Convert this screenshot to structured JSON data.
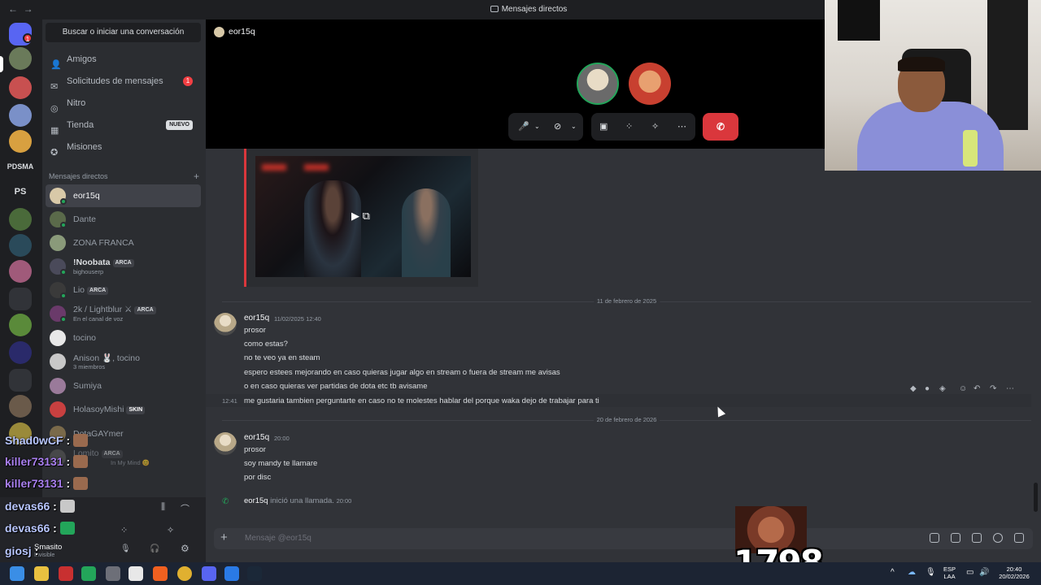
{
  "window": {
    "title": "Mensajes directos"
  },
  "servers": [
    {
      "label": "PDSMA"
    },
    {
      "label": "PS"
    }
  ],
  "sidebar": {
    "search_label": "Buscar o iniciar una conversación",
    "nav": [
      {
        "label": "Amigos",
        "icon": "friends-icon"
      },
      {
        "label": "Solicitudes de mensajes",
        "icon": "mail-icon",
        "badge": "1"
      },
      {
        "label": "Nitro",
        "icon": "nitro-icon"
      },
      {
        "label": "Tienda",
        "icon": "shop-icon",
        "tag": "NUEVO"
      },
      {
        "label": "Misiones",
        "icon": "quests-icon"
      }
    ],
    "dm_header": "Mensajes directos",
    "dms": [
      {
        "name": "eor15q"
      },
      {
        "name": "Dante"
      },
      {
        "name": "ZONA FRANCA"
      },
      {
        "name": "!Noobata",
        "tag": "ARCA",
        "sub": "bighouserp"
      },
      {
        "name": "Lio",
        "tag": "ARCA"
      },
      {
        "name": "2k / Lightblur ⚔",
        "tag": "ARCA",
        "sub": "En el canal de voz"
      },
      {
        "name": "tocino"
      },
      {
        "name": "Anison 🐰, tocino",
        "sub": "3 miembros"
      },
      {
        "name": "Sumiya"
      },
      {
        "name": "HolasoyMishi",
        "tag": "SKIN"
      },
      {
        "name": "DotaGAYmer"
      },
      {
        "name": "Lomito",
        "tag": "ARCA",
        "sub": "In My Mind 😊"
      }
    ]
  },
  "user_panel": {
    "name": "Smasito",
    "status": "Invisible"
  },
  "call": {
    "channel_user": "eor15q",
    "hangup_label": "✆"
  },
  "chat": {
    "dividers": [
      "11 de febrero de 2025",
      "20 de febrero de 2026"
    ],
    "group1": {
      "author": "eor15q",
      "time": "11/02/2025 12:40",
      "lines": [
        "prosor",
        "como estas?",
        "no te veo ya en steam",
        "espero estees mejorando en caso quieras jugar algo en stream o fuera de stream me avisas",
        "o en caso quieras ver partidas de dota etc tb avisame"
      ],
      "hover_time": "12:41",
      "hover_line": "me gustaria tambien perguntarte en caso no te molestes hablar del porque waka dejo de trabajar para ti"
    },
    "group2": {
      "author": "eor15q",
      "time": "20:00",
      "lines": [
        "prosor",
        "soy mandy te llamare",
        "por disc"
      ]
    },
    "system": {
      "author": "eor15q",
      "text": "inició una llamada.",
      "time": "20:00"
    },
    "composer_placeholder": "Mensaje @eor15q"
  },
  "overlay": {
    "lines": [
      {
        "user": "Shad0wCF",
        "text": ":"
      },
      {
        "user": "killer73131",
        "text": ":"
      },
      {
        "user": "killer73131",
        "text": ":"
      },
      {
        "user": "devas66",
        "text": ":"
      },
      {
        "user": "devas66",
        "text": ":"
      },
      {
        "user": "giosj",
        "text": ":"
      }
    ],
    "big_number": "1798"
  },
  "taskbar": {
    "lang": "ESP",
    "lang2": "LAA",
    "time": "20:40",
    "date": "20/02/2026"
  }
}
